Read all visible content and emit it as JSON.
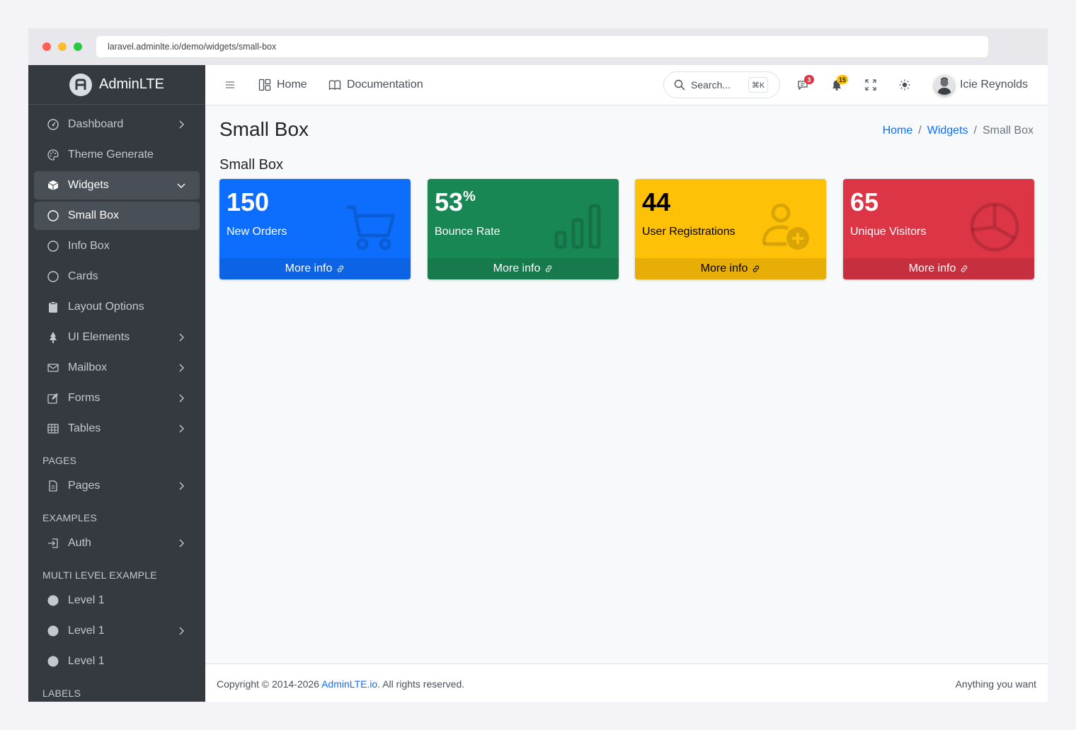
{
  "browser": {
    "url": "laravel.adminlte.io/demo/widgets/small-box"
  },
  "brand": {
    "name": "AdminLTE"
  },
  "sidebar": {
    "items": [
      {
        "label": "Dashboard",
        "icon": "speedometer-icon",
        "chevron": "right"
      },
      {
        "label": "Theme Generate",
        "icon": "palette-icon"
      },
      {
        "label": "Widgets",
        "icon": "box-icon",
        "chevron": "down",
        "open": true
      },
      {
        "label": "Small Box",
        "icon": "circle-icon",
        "active": true
      },
      {
        "label": "Info Box",
        "icon": "circle-icon"
      },
      {
        "label": "Cards",
        "icon": "circle-icon"
      },
      {
        "label": "Layout Options",
        "icon": "clipboard-icon"
      },
      {
        "label": "UI Elements",
        "icon": "tree-icon",
        "chevron": "right"
      },
      {
        "label": "Mailbox",
        "icon": "envelope-icon",
        "chevron": "right"
      },
      {
        "label": "Forms",
        "icon": "pencil-square-icon",
        "chevron": "right"
      },
      {
        "label": "Tables",
        "icon": "table-icon",
        "chevron": "right"
      }
    ],
    "header_pages": "PAGES",
    "pages": {
      "label": "Pages",
      "icon": "file-icon",
      "chevron": "right"
    },
    "header_examples": "EXAMPLES",
    "auth": {
      "label": "Auth",
      "icon": "login-icon",
      "chevron": "right"
    },
    "header_multi": "MULTI LEVEL EXAMPLE",
    "levels": [
      {
        "label": "Level 1"
      },
      {
        "label": "Level 1",
        "chevron": "right"
      },
      {
        "label": "Level 1"
      }
    ],
    "header_labels": "LABELS"
  },
  "topbar": {
    "home": "Home",
    "documentation": "Documentation",
    "search_placeholder": "Search...",
    "search_shortcut": "⌘K",
    "messages_count": "3",
    "notifications_count": "15",
    "user_name": "Icie Reynolds"
  },
  "page": {
    "title": "Small Box",
    "breadcrumb": {
      "home": "Home",
      "widgets": "Widgets",
      "current": "Small Box"
    },
    "section_title": "Small Box"
  },
  "boxes": [
    {
      "value": "150",
      "suffix": "",
      "label": "New Orders",
      "footer": "More info",
      "bg": "#0d6efd",
      "footer_bg": "#0c63e4",
      "text": "#ffffff",
      "icon": "cart-icon"
    },
    {
      "value": "53",
      "suffix": "%",
      "label": "Bounce Rate",
      "footer": "More info",
      "bg": "#198754",
      "footer_bg": "#167a4c",
      "text": "#ffffff",
      "icon": "bar-chart-icon"
    },
    {
      "value": "44",
      "suffix": "",
      "label": "User Registrations",
      "footer": "More info",
      "bg": "#ffc107",
      "footer_bg": "#e6ae06",
      "text": "#000000",
      "icon": "person-plus-icon"
    },
    {
      "value": "65",
      "suffix": "",
      "label": "Unique Visitors",
      "footer": "More info",
      "bg": "#dc3545",
      "footer_bg": "#c6303e",
      "text": "#ffffff",
      "icon": "pie-chart-icon"
    }
  ],
  "footer": {
    "prefix": "Copyright © 2014-2026 ",
    "link": "AdminLTE.io",
    "suffix": ". All rights reserved.",
    "right": "Anything you want"
  }
}
